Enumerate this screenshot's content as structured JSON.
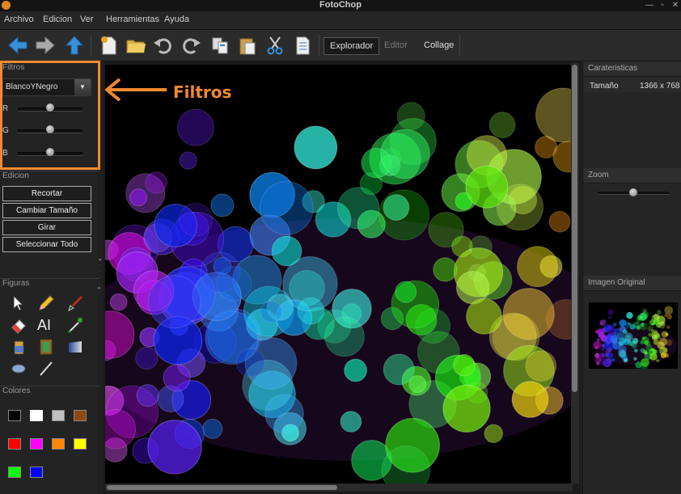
{
  "window": {
    "title": "FotoChop",
    "controls": [
      "—",
      "▫",
      "✕"
    ]
  },
  "menu": [
    "Archivo",
    "Edicion",
    "Ver",
    "Herramientas",
    "Ayuda"
  ],
  "toolbar": {
    "icons": [
      "back-arrow-icon",
      "forward-arrow-icon",
      "up-arrow-icon",
      "new-file-icon",
      "open-folder-icon",
      "undo-icon",
      "redo-icon",
      "copy-icon",
      "paste-icon",
      "cut-icon",
      "document-icon"
    ],
    "tabs": [
      "Explorador",
      "Editor",
      "Collage"
    ],
    "active_tab": "Explorador"
  },
  "filtros": {
    "header": "Filtros",
    "selected": "BlancoYNegro",
    "sliders": [
      {
        "label": "R",
        "value": 0.5
      },
      {
        "label": "G",
        "value": 0.5
      },
      {
        "label": "B",
        "value": 0.5
      }
    ]
  },
  "edicion": {
    "header": "Edicion",
    "buttons": [
      "Recortar",
      "Cambiar Tamaño",
      "Girar",
      "Seleccionar Todo"
    ]
  },
  "figuras": {
    "header": "Figuras",
    "tools": [
      "cursor-icon",
      "pencil-icon",
      "brush-icon",
      "eraser-icon",
      "text-tool-icon",
      "dropper-icon",
      "paint-bucket-icon",
      "frame-icon",
      "gradient-icon",
      "ellipse-icon",
      "line-icon"
    ]
  },
  "colores": {
    "header": "Colores",
    "swatches": [
      "#000000",
      "#ffffff",
      "#c0c0c0",
      "#8b4a10",
      "#ff0000",
      "#ff00ff",
      "#ff8800",
      "#ffff00",
      "#00ff00",
      "#0000ff"
    ],
    "selected_index": 1
  },
  "caracteristicas": {
    "header": "Carateristicas",
    "rows": [
      {
        "label": "Tamaño",
        "value": "1366 x 768"
      }
    ]
  },
  "zoom": {
    "header": "Zoom",
    "value": 0.55
  },
  "imagen_original": {
    "header": "Imagen Original"
  },
  "annotation": {
    "text": "Filtros"
  }
}
